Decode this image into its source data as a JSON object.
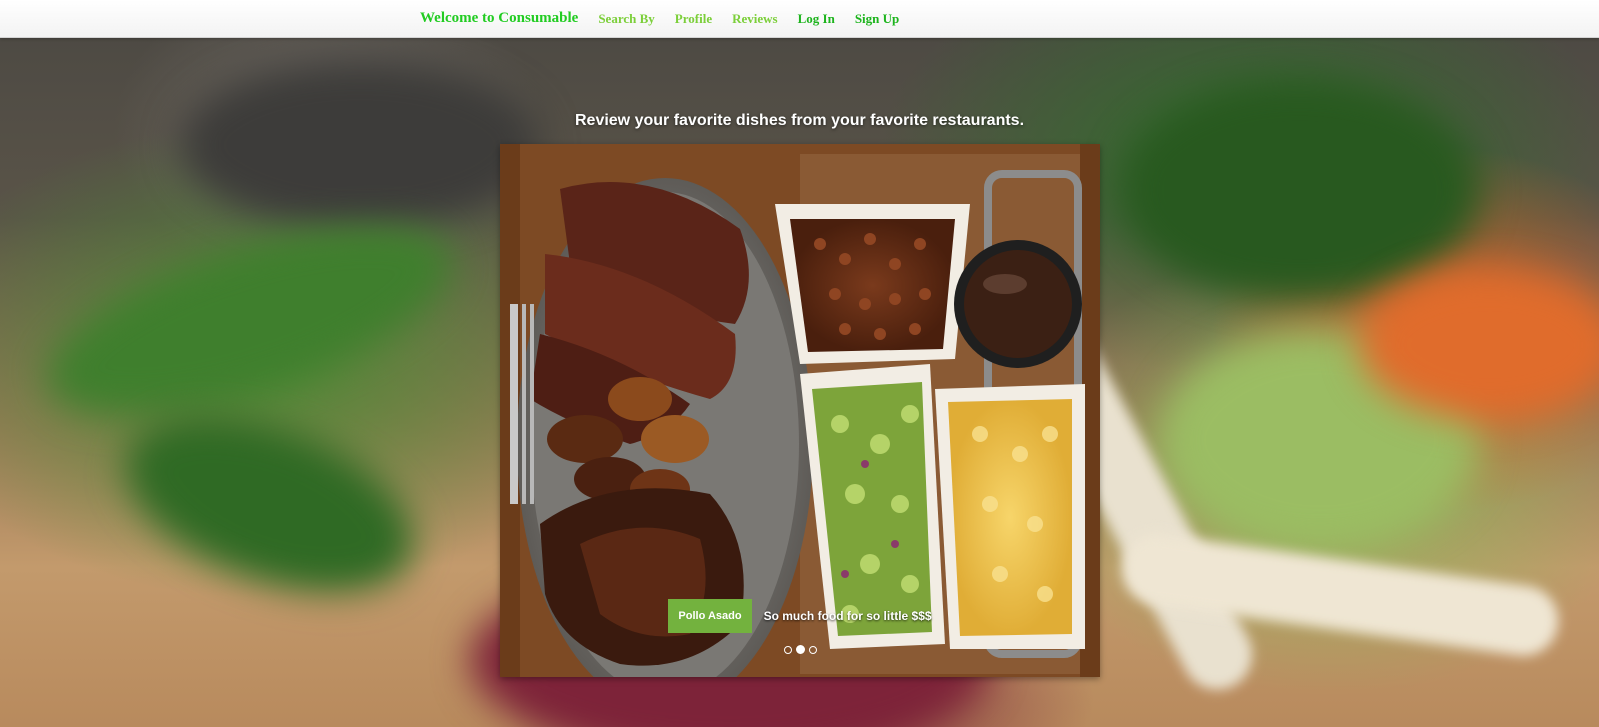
{
  "nav": {
    "brand": "Welcome to Consumable",
    "items": [
      {
        "label": "Search By"
      },
      {
        "label": "Profile"
      },
      {
        "label": "Reviews"
      },
      {
        "label": "Log In"
      },
      {
        "label": "Sign Up"
      }
    ]
  },
  "hero": {
    "tagline": "Review your favorite dishes from your favorite restaurants."
  },
  "carousel": {
    "active_index": 1,
    "slide_count": 3,
    "caption": {
      "title": "Pollo Asado",
      "text": "So much food for so little $$$"
    }
  },
  "colors": {
    "brand_green": "#22cc22",
    "nav_light_green": "#7ccf3a",
    "nav_strong_green": "#1db41d",
    "caption_green": "#73b23e"
  },
  "icons": {
    "carousel_indicator": "circle-dot-icon"
  }
}
